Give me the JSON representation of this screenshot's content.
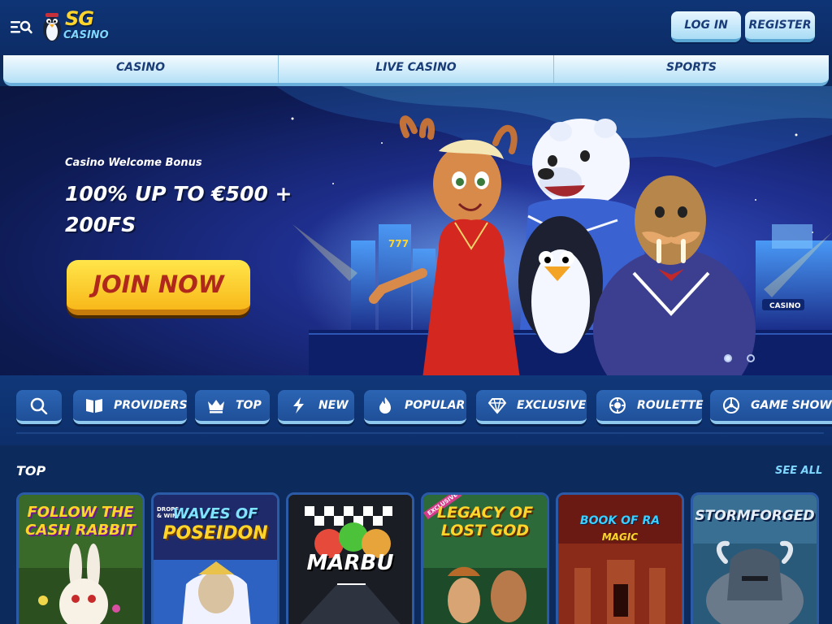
{
  "header": {
    "logo_main": "SG",
    "logo_sub": "CASINO",
    "login_label": "LOG IN",
    "register_label": "REGISTER"
  },
  "nav": {
    "tabs": [
      {
        "label": "CASINO"
      },
      {
        "label": "LIVE CASINO"
      },
      {
        "label": "SPORTS"
      }
    ]
  },
  "hero": {
    "subtitle": "Casino Welcome Bonus",
    "title": "100% UP TO €500 + 200FS",
    "cta_label": "JOIN NOW",
    "casino_sign": "CASINO",
    "slides_count": 2,
    "active_slide": 1
  },
  "categories": {
    "items": [
      {
        "label": "PROVIDERS",
        "icon": "book-icon"
      },
      {
        "label": "TOP",
        "icon": "crown-icon"
      },
      {
        "label": "NEW",
        "icon": "lightning-icon"
      },
      {
        "label": "POPULAR",
        "icon": "flame-icon"
      },
      {
        "label": "EXCLUSIVE",
        "icon": "diamond-icon"
      },
      {
        "label": "ROULETTE",
        "icon": "roulette-icon"
      },
      {
        "label": "GAME SHOWS",
        "icon": "wheel-icon"
      }
    ]
  },
  "top_section": {
    "title": "TOP",
    "see_all_label": "SEE ALL",
    "games": [
      {
        "title_line1": "FOLLOW THE",
        "title_line2": "CASH RABBIT"
      },
      {
        "badge": "DROPS & WINS",
        "title_line1": "WAVES OF",
        "title_line2": "POSEIDON"
      },
      {
        "title_line1": "MARBU"
      },
      {
        "badge": "EXCLUSIVE",
        "title_line1": "LEGACY OF",
        "title_line2": "LOST GOD"
      },
      {
        "title_line1": "BOOK OF RA",
        "title_line2": "MAGIC"
      },
      {
        "title_line1": "STORMFORGED"
      }
    ]
  },
  "colors": {
    "primary_bg": "#0c2a5c",
    "accent_yellow": "#ffd42b",
    "accent_light_blue": "#a9dcf5",
    "cta_text": "#b0281c"
  }
}
